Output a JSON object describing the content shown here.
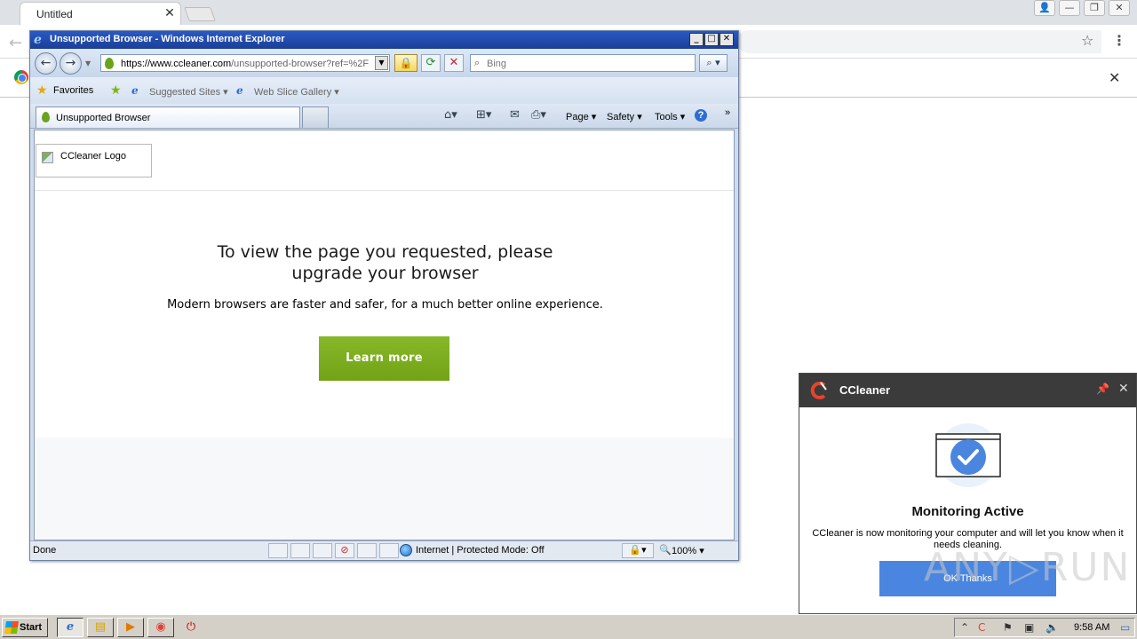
{
  "chrome": {
    "tab_title": "Untitled",
    "tab_close": "✕",
    "back_icon": "←",
    "star_icon": "☆",
    "menu_icon": "⋮",
    "infobar_close": "✕",
    "win_buttons": [
      "👤",
      "—",
      "❐",
      "✕"
    ]
  },
  "ie": {
    "title": "Unsupported Browser - Windows Internet Explorer",
    "caption_buttons": {
      "minimize": "_",
      "maximize": "□",
      "close": "✕"
    },
    "back_icon": "←",
    "forward_icon": "→",
    "address_host": "https://www.ccleaner.com",
    "address_path": "/unsupported-browser?ref=%2F",
    "search_placeholder": "Bing",
    "favorites_label": "Favorites",
    "favorites_items": [
      "Suggested Sites ▾",
      "Web Slice Gallery ▾"
    ],
    "tab_title": "Unsupported Browser",
    "commands": {
      "page": "Page ▾",
      "safety": "Safety ▾",
      "tools": "Tools ▾",
      "help": "?",
      "more": "»"
    },
    "status": {
      "done": "Done",
      "zone": "Internet | Protected Mode: Off",
      "zoom": "100% ▾"
    }
  },
  "page": {
    "logo_alt": "CCleaner Logo",
    "heading_line1": "To view the page you requested, please",
    "heading_line2": "upgrade your browser",
    "subtext": "Modern browsers are faster and safer, for a much better online experience.",
    "cta_label": "Learn more"
  },
  "ccleaner_popup": {
    "title": "CCleaner",
    "heading": "Monitoring Active",
    "body": "CCleaner is now monitoring your computer and will let you know when it needs cleaning.",
    "ok_label": "OK Thanks",
    "accent_color": "#4a86e0"
  },
  "watermark": "ANY▷RUN",
  "taskbar": {
    "start_label": "Start",
    "clock": "9:58 AM"
  },
  "colors": {
    "cta_green": "#78a81c",
    "ie_title_blue": "#1f47a8",
    "cc_header": "#3b3b3b"
  }
}
